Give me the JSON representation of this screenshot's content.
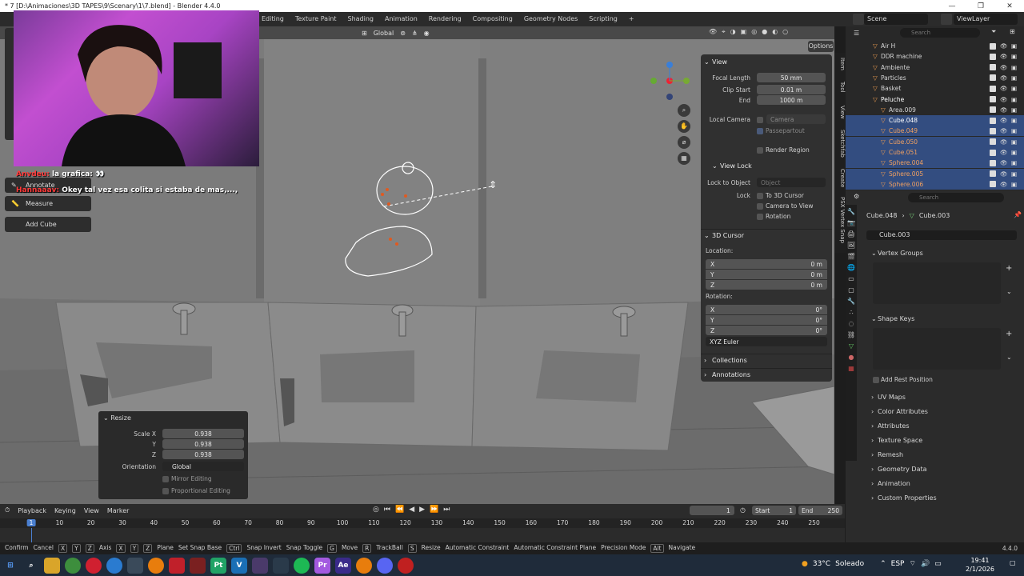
{
  "titlebar": {
    "title": "* 7 [D:\\Animaciones\\3D TAPES\\9\\Scenary\\1\\7.blend] - Blender 4.4.0",
    "min": "—",
    "max": "❐",
    "close": "✕"
  },
  "workspaces": [
    "Editing",
    "Texture Paint",
    "Shading",
    "Animation",
    "Rendering",
    "Compositing",
    "Geometry Nodes",
    "Scripting"
  ],
  "add_ws": "+",
  "scene": {
    "label": "Scene",
    "viewlayer": "ViewLayer"
  },
  "vp_header": {
    "orientation": "Global",
    "options": "Options"
  },
  "chat": [
    {
      "user": "Anvdeu:",
      "text": "la grafica: 👀"
    },
    {
      "user": "Hannaaav:",
      "text": "Okey tal vez esa colita si estaba de mas,...,"
    }
  ],
  "tools": {
    "annotate": "Annotate",
    "measure": "Measure",
    "add_cube": "Add Cube"
  },
  "npanel": {
    "view_header": "View",
    "focal_length_label": "Focal Length",
    "focal_length": "50 mm",
    "clip_start_label": "Clip Start",
    "clip_start": "0.01 m",
    "end_label": "End",
    "end": "1000 m",
    "local_camera_label": "Local Camera",
    "camera": "Camera",
    "passepartout": "Passepartout",
    "render_region": "Render Region",
    "view_lock_header": "View Lock",
    "lock_to_object_label": "Lock to Object",
    "object_placeholder": "Object",
    "lock_label": "Lock",
    "to_3d_cursor": "To 3D Cursor",
    "camera_to_view": "Camera to View",
    "rotation_chk": "Rotation",
    "cursor_header": "3D Cursor",
    "location_label": "Location:",
    "loc": [
      {
        "axis": "X",
        "val": "0 m"
      },
      {
        "axis": "Y",
        "val": "0 m"
      },
      {
        "axis": "Z",
        "val": "0 m"
      }
    ],
    "rotation_label": "Rotation:",
    "rot": [
      {
        "axis": "X",
        "val": "0°"
      },
      {
        "axis": "Y",
        "val": "0°"
      },
      {
        "axis": "Z",
        "val": "0°"
      }
    ],
    "euler": "XYZ Euler",
    "collections": "Collections",
    "annotations": "Annotations"
  },
  "sidetabs": [
    "Item",
    "Tool",
    "View",
    "Sketchfab",
    "Create",
    "PSX Vertex Snap"
  ],
  "resize": {
    "header": "Resize",
    "scale_x_label": "Scale X",
    "scale_x": "0.938",
    "y_label": "Y",
    "y": "0.938",
    "z_label": "Z",
    "z": "0.938",
    "orientation_label": "Orientation",
    "orientation": "Global",
    "mirror": "Mirror Editing",
    "proportional": "Proportional Editing"
  },
  "timeline": {
    "menus": [
      "Playback",
      "Keying",
      "View",
      "Marker"
    ],
    "current_frame": "1",
    "start_label": "Start",
    "start": "1",
    "end_label": "End",
    "end": "250",
    "ruler": [
      "1",
      "10",
      "20",
      "30",
      "40",
      "50",
      "60",
      "70",
      "80",
      "90",
      "100",
      "110",
      "120",
      "130",
      "140",
      "150",
      "160",
      "170",
      "180",
      "190",
      "200",
      "210",
      "220",
      "230",
      "240",
      "250"
    ]
  },
  "outliner": {
    "search_placeholder": "Search",
    "rows": [
      {
        "name": "Air H",
        "indent": 0,
        "color": "#d6d6d6",
        "sel": false
      },
      {
        "name": "DDR machine",
        "indent": 0,
        "color": "#d6d6d6",
        "sel": false
      },
      {
        "name": "Ambiente",
        "indent": 0,
        "color": "#d6d6d6",
        "sel": false
      },
      {
        "name": "Particles",
        "indent": 0,
        "color": "#d6d6d6",
        "sel": false
      },
      {
        "name": "Basket",
        "indent": 0,
        "color": "#d6d6d6",
        "sel": false
      },
      {
        "name": "Peluche",
        "indent": 0,
        "color": "#ffffff",
        "sel": false
      },
      {
        "name": "Area.009",
        "indent": 1,
        "color": "#d6d6d6",
        "sel": false
      },
      {
        "name": "Cube.048",
        "indent": 1,
        "color": "#ffffff",
        "sel": true
      },
      {
        "name": "Cube.049",
        "indent": 1,
        "color": "#f0a060",
        "sel": true
      },
      {
        "name": "Cube.050",
        "indent": 1,
        "color": "#f0a060",
        "sel": true
      },
      {
        "name": "Cube.051",
        "indent": 1,
        "color": "#f0a060",
        "sel": true
      },
      {
        "name": "Sphere.004",
        "indent": 1,
        "color": "#f0a060",
        "sel": true
      },
      {
        "name": "Sphere.005",
        "indent": 1,
        "color": "#f0a060",
        "sel": true
      },
      {
        "name": "Sphere.006",
        "indent": 1,
        "color": "#f0a060",
        "sel": true
      }
    ]
  },
  "props": {
    "search_placeholder": "Search",
    "breadcrumb_obj": "Cube.048",
    "breadcrumb_mesh": "Cube.003",
    "mesh_name": "Cube.003",
    "vertex_groups": "Vertex Groups",
    "shape_keys": "Shape Keys",
    "add_rest": "Add Rest Position",
    "sections": [
      "UV Maps",
      "Color Attributes",
      "Attributes",
      "Texture Space",
      "Remesh",
      "Geometry Data",
      "Animation",
      "Custom Properties"
    ]
  },
  "statusbar": {
    "items": [
      "Confirm",
      "Cancel",
      "X",
      "Y",
      "Z",
      "Axis",
      "X",
      "Y",
      "Z",
      "Plane",
      "Set Snap Base",
      "Ctrl",
      "Snap Invert",
      "Snap Toggle",
      "G",
      "Move",
      "R",
      "TrackBall",
      "S",
      "Resize",
      "Automatic Constraint",
      "Automatic Constraint Plane",
      "Precision Mode",
      "Alt",
      "Navigate"
    ],
    "version": "4.4.0"
  },
  "taskbar": {
    "weather_temp": "33°C",
    "weather_desc": "Soleado",
    "lang": "ESP",
    "time": "19:41",
    "date": "2/1/2026"
  }
}
